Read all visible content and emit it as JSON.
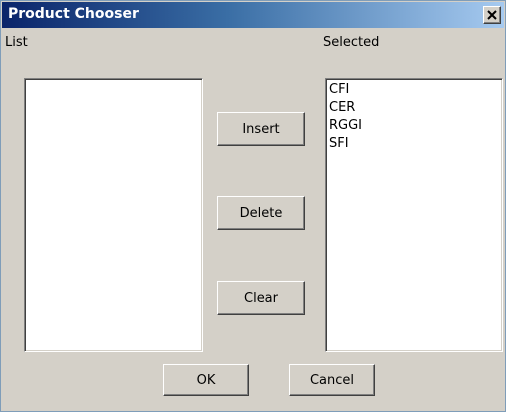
{
  "window": {
    "title": "Product Chooser"
  },
  "icons": {
    "close": "close-icon"
  },
  "left_panel": {
    "label": "List",
    "items": []
  },
  "right_panel": {
    "label": "Selected",
    "items": [
      "CFI",
      "CER",
      "RGGI",
      "SFI"
    ]
  },
  "buttons": {
    "insert": "Insert",
    "delete": "Delete",
    "clear": "Clear",
    "ok": "OK",
    "cancel": "Cancel"
  }
}
